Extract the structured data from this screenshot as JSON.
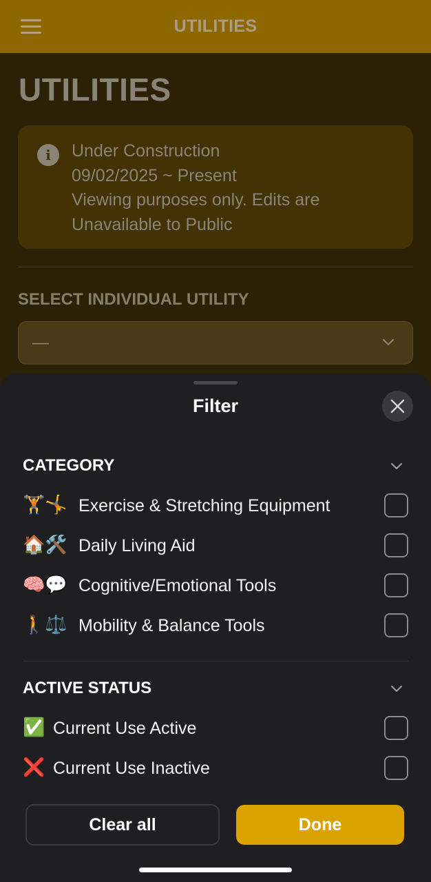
{
  "topbar": {
    "title": "UTILITIES"
  },
  "page": {
    "title": "UTILITIES"
  },
  "notice": {
    "icon": "info-icon",
    "lines": [
      "Under Construction",
      "09/02/2025 ~ Present",
      "Viewing purposes only. Edits are",
      "Unavailable to Public"
    ]
  },
  "select": {
    "label": "SELECT INDIVIDUAL UTILITY",
    "value": "—"
  },
  "filter": {
    "title": "Filter",
    "sections": [
      {
        "title": "CATEGORY",
        "items": [
          {
            "emoji": "🏋️🤸",
            "label": "Exercise & Stretching Equipment",
            "checked": false
          },
          {
            "emoji": "🏠🛠️",
            "label": "Daily Living Aid",
            "checked": false
          },
          {
            "emoji": "🧠💬",
            "label": "Cognitive/Emotional Tools",
            "checked": false
          },
          {
            "emoji": "🚶⚖️",
            "label": "Mobility & Balance Tools",
            "checked": false
          }
        ]
      },
      {
        "title": "ACTIVE STATUS",
        "items": [
          {
            "emoji": "✅",
            "label": "Current Use Active",
            "checked": false
          },
          {
            "emoji": "❌",
            "label": "Current Use Inactive",
            "checked": false
          }
        ]
      }
    ],
    "clear_label": "Clear all",
    "done_label": "Done"
  },
  "colors": {
    "topbar": "#8f6700",
    "page_background": "#2c2106",
    "sheet_background": "#1f1f21",
    "accent": "#dba300"
  }
}
